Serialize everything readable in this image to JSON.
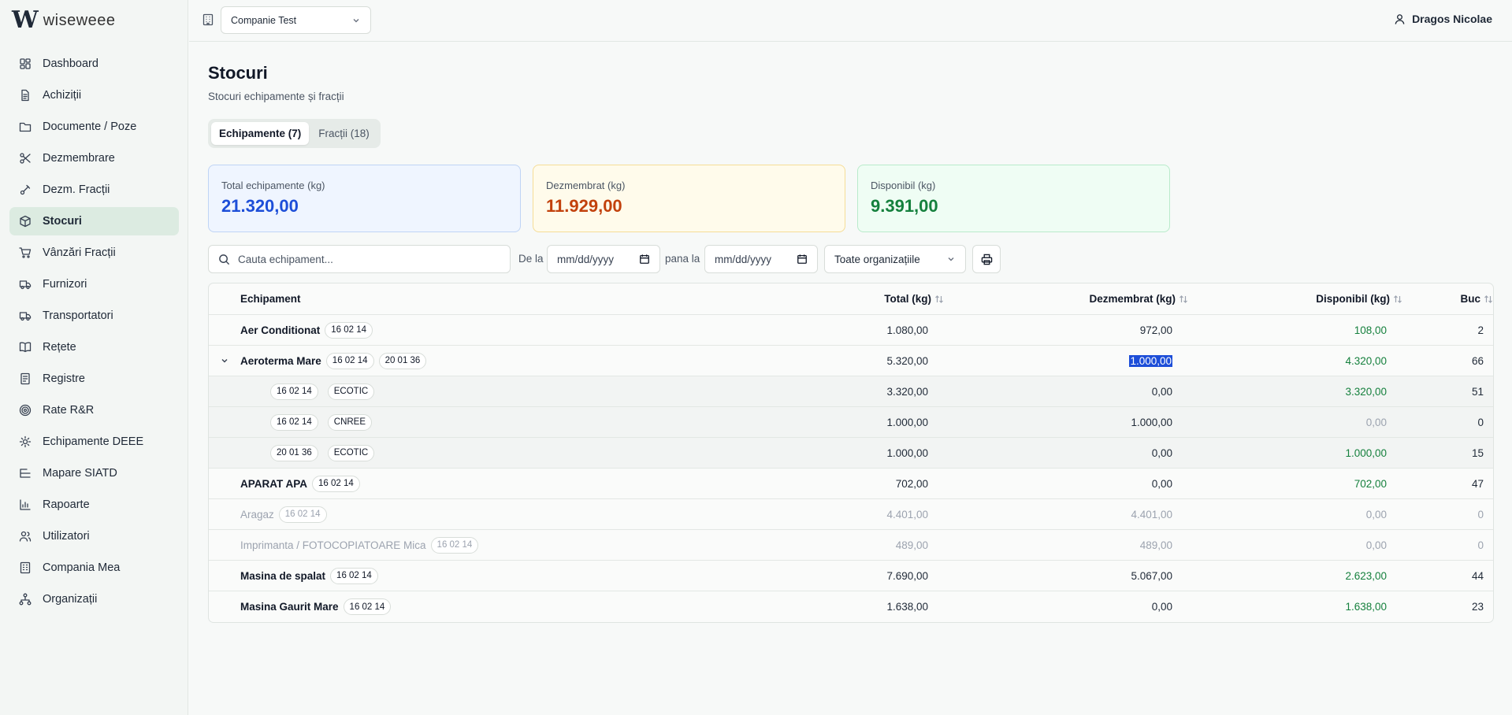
{
  "app": {
    "logo_mark": "W",
    "logo_text": "wiseweee"
  },
  "sidebar": {
    "items": [
      {
        "label": "Dashboard",
        "icon": "dashboard-icon"
      },
      {
        "label": "Achiziții",
        "icon": "document-icon"
      },
      {
        "label": "Documente / Poze",
        "icon": "folder-icon"
      },
      {
        "label": "Dezmembrare",
        "icon": "scissors-icon"
      },
      {
        "label": "Dezm. Fracții",
        "icon": "tools-icon"
      },
      {
        "label": "Stocuri",
        "icon": "box-icon",
        "active": true
      },
      {
        "label": "Vânzări Fracții",
        "icon": "cart-icon"
      },
      {
        "label": "Furnizori",
        "icon": "truck-icon"
      },
      {
        "label": "Transportatori",
        "icon": "truck-icon"
      },
      {
        "label": "Rețete",
        "icon": "book-icon"
      },
      {
        "label": "Registre",
        "icon": "register-icon"
      },
      {
        "label": "Rate R&R",
        "icon": "target-icon"
      },
      {
        "label": "Echipamente DEEE",
        "icon": "chip-icon"
      },
      {
        "label": "Mapare SIATD",
        "icon": "list-tree-icon"
      },
      {
        "label": "Rapoarte",
        "icon": "bar-chart-icon"
      },
      {
        "label": "Utilizatori",
        "icon": "users-icon"
      },
      {
        "label": "Compania Mea",
        "icon": "building-icon"
      },
      {
        "label": "Organizații",
        "icon": "network-icon"
      }
    ]
  },
  "topbar": {
    "company": "Companie Test",
    "user": "Dragos Nicolae"
  },
  "page": {
    "title": "Stocuri",
    "subtitle": "Stocuri echipamente și fracții"
  },
  "tabs": [
    {
      "label": "Echipamente (7)",
      "active": true
    },
    {
      "label": "Fracții (18)",
      "active": false
    }
  ],
  "cards": {
    "total": {
      "label": "Total echipamente (kg)",
      "value": "21.320,00"
    },
    "dezmembrat": {
      "label": "Dezmembrat (kg)",
      "value": "11.929,00"
    },
    "disponibil": {
      "label": "Disponibil (kg)",
      "value": "9.391,00"
    }
  },
  "filters": {
    "search_placeholder": "Cauta echipament...",
    "from_label": "De la",
    "to_label": "pana la",
    "date_placeholder": "mm/dd/yyyy",
    "org_select": "Toate organizațiile"
  },
  "table": {
    "headers": {
      "name": "Echipament",
      "total": "Total (kg)",
      "dez": "Dezmembrat (kg)",
      "disp": "Disponibil (kg)",
      "buc": "Buc"
    },
    "rows": [
      {
        "name": "Aer Conditionat",
        "codes": [
          "16 02 14"
        ],
        "total": "1.080,00",
        "dez": "972,00",
        "disp": "108,00",
        "buc": "2",
        "kind": "main"
      },
      {
        "name": "Aeroterma Mare",
        "codes": [
          "16 02 14",
          "20 01 36"
        ],
        "total": "5.320,00",
        "dez": "1.000,00",
        "disp": "4.320,00",
        "buc": "66",
        "kind": "expanded"
      },
      {
        "name": "",
        "codes": [
          "16 02 14",
          "ECOTIC"
        ],
        "total": "3.320,00",
        "dez": "0,00",
        "disp": "3.320,00",
        "buc": "51",
        "kind": "sub"
      },
      {
        "name": "",
        "codes": [
          "16 02 14",
          "CNREE"
        ],
        "total": "1.000,00",
        "dez": "1.000,00",
        "disp": "0,00",
        "buc": "0",
        "kind": "sub-zero"
      },
      {
        "name": "",
        "codes": [
          "20 01 36",
          "ECOTIC"
        ],
        "total": "1.000,00",
        "dez": "0,00",
        "disp": "1.000,00",
        "buc": "15",
        "kind": "sub"
      },
      {
        "name": "APARAT APA",
        "codes": [
          "16 02 14"
        ],
        "total": "702,00",
        "dez": "0,00",
        "disp": "702,00",
        "buc": "47",
        "kind": "main"
      },
      {
        "name": "Aragaz",
        "codes": [
          "16 02 14"
        ],
        "total": "4.401,00",
        "dez": "4.401,00",
        "disp": "0,00",
        "buc": "0",
        "kind": "muted"
      },
      {
        "name": "Imprimanta / FOTOCOPIATOARE Mica",
        "codes": [
          "16 02 14"
        ],
        "total": "489,00",
        "dez": "489,00",
        "disp": "0,00",
        "buc": "0",
        "kind": "muted"
      },
      {
        "name": "Masina de spalat",
        "codes": [
          "16 02 14"
        ],
        "total": "7.690,00",
        "dez": "5.067,00",
        "disp": "2.623,00",
        "buc": "44",
        "kind": "main"
      },
      {
        "name": "Masina Gaurit Mare",
        "codes": [
          "16 02 14"
        ],
        "total": "1.638,00",
        "dez": "0,00",
        "disp": "1.638,00",
        "buc": "23",
        "kind": "main"
      }
    ]
  }
}
